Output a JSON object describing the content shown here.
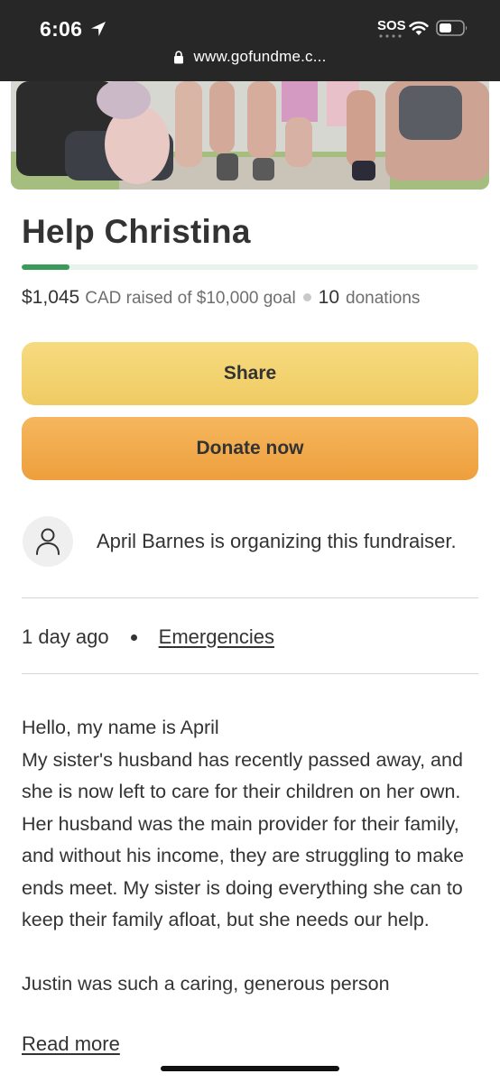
{
  "status_bar": {
    "time": "6:06",
    "sos": "SOS",
    "url": "www.gofundme.c..."
  },
  "campaign": {
    "title": "Help Christina",
    "raised_amount": "$1,045",
    "raised_suffix": "CAD raised of $10,000 goal",
    "donation_count": "10",
    "donation_label": "donations",
    "progress_fraction": 0.1045
  },
  "buttons": {
    "share": "Share",
    "donate": "Donate now"
  },
  "organizer": {
    "text": "April Barnes is organizing this fundraiser."
  },
  "meta": {
    "time_ago": "1 day ago",
    "category": "Emergencies"
  },
  "story": {
    "greeting": "Hello, my name is April",
    "paragraph_1": "My sister's husband has recently passed away, and she is now left to care for their children on her own. Her husband was the main provider for their family, and without his income, they are struggling to make ends meet. My sister is doing everything she can to keep their family afloat, but she needs our help.",
    "paragraph_2": "Justin was such a caring, generous person",
    "read_more": "Read more"
  },
  "colors": {
    "progress": "#3a9a59",
    "share_button": "#f0cb63",
    "donate_button": "#ee9f3d"
  },
  "icons": {
    "location": "location-arrow-icon",
    "wifi": "wifi-icon",
    "battery": "battery-icon",
    "lock": "lock-icon",
    "avatar": "person-icon"
  }
}
